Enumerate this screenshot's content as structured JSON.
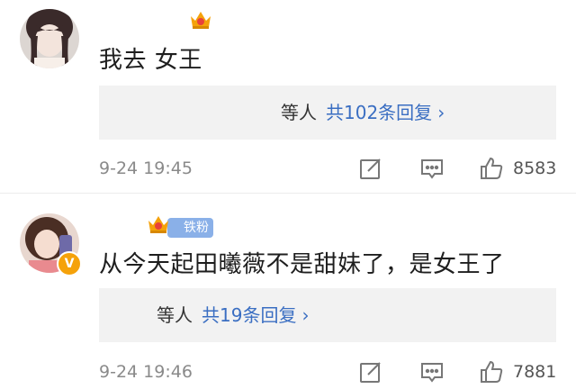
{
  "comments": [
    {
      "text": "我去 女王",
      "replies": {
        "who": "等人",
        "count": "共102条回复",
        "chevron": "›"
      },
      "time": "9-24 19:45",
      "likes": "8583"
    },
    {
      "fan_tag": "铁粉",
      "vip_badge": "V",
      "text": "从今天起田曦薇不是甜妹了，是女王了",
      "replies": {
        "who": "等人",
        "count": "共19条回复",
        "chevron": "›"
      },
      "time": "9-24 19:46",
      "likes": "7881"
    }
  ],
  "colors": {
    "link": "#3a6ec2",
    "reply_bg": "#f2f2f2",
    "muted": "#8a8a8a",
    "crown": "#f5a20a"
  },
  "icons": [
    "edit-icon",
    "comment-icon",
    "like-icon",
    "crown-badge-icon"
  ]
}
